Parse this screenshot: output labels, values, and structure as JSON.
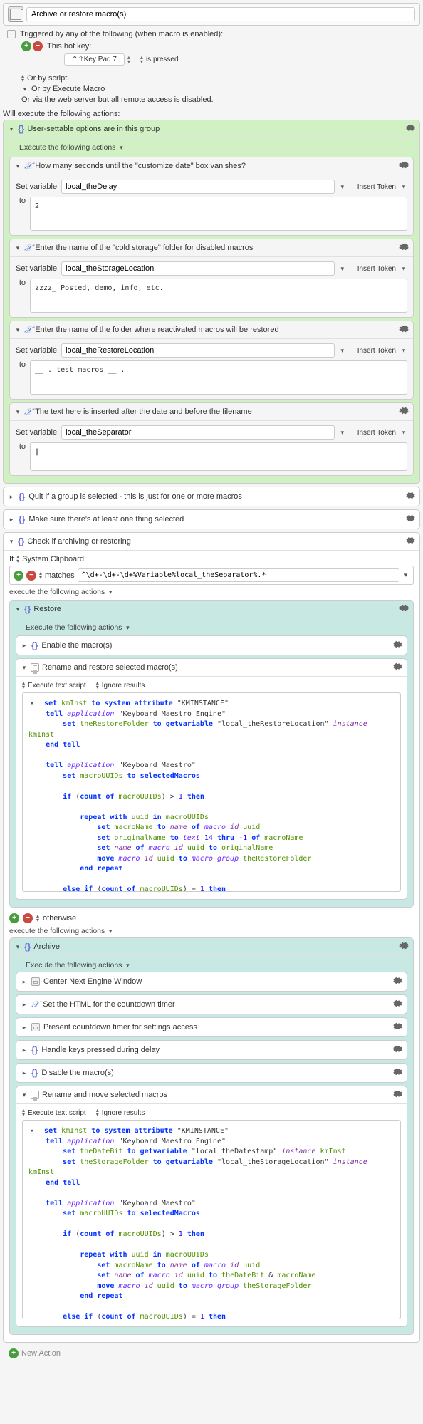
{
  "title": "Archive or restore macro(s)",
  "trigger_label": "Triggered by any of the following (when macro is enabled):",
  "hotkey_label": "This hot key:",
  "hotkey_value": "⌃⇧Key Pad 7",
  "hotkey_mode": "is pressed",
  "trig_or_script": "Or by script.",
  "trig_or_execute": "Or by Execute Macro",
  "trig_or_web": "Or via the web server but all remote access is disabled.",
  "will_execute": "Will execute the following actions:",
  "user_opts_title": "User-settable options are in this group",
  "exec_following": "Execute the following actions",
  "setvars": [
    {
      "title": "How many seconds until the \"customize date\" box vanishes?",
      "label": "Set variable",
      "name": "local_theDelay",
      "insert": "Insert Token",
      "to": "to",
      "value": "2"
    },
    {
      "title": "Enter the name of the \"cold storage\" folder for disabled macros",
      "label": "Set variable",
      "name": "local_theStorageLocation",
      "insert": "Insert Token",
      "to": "to",
      "value": "zzzz_ Posted, demo, info, etc."
    },
    {
      "title": "Enter the name of the folder where reactivated macros will be restored",
      "label": "Set variable",
      "name": "local_theRestoreLocation",
      "insert": "Insert Token",
      "to": "to",
      "value": "__ . test macros __ ."
    },
    {
      "title": "The text here is inserted after the date and before the filename",
      "label": "Set variable",
      "name": "local_theSeparator",
      "insert": "Insert Token",
      "to": "to",
      "value": ""
    }
  ],
  "quit_group": "Quit if a group is selected - this is just for one or more macros",
  "make_sure": "Make sure there's at least one thing selected",
  "check_title": "Check if archiving or restoring",
  "if_clip": "If",
  "sys_clip": "System Clipboard",
  "matches": "matches",
  "regex": "^\\d+-\\d+-\\d+%Variable%local_theSeparator%.*",
  "exec_actions_lc": "execute the following actions",
  "restore_title": "Restore",
  "enable_macros": "Enable the macro(s)",
  "rename_restore": "Rename and restore selected macro(s)",
  "exec_text_script": "Execute text script",
  "ignore_results": "Ignore results",
  "otherwise": "otherwise",
  "archive_title": "Archive",
  "a1": "Center Next Engine Window",
  "a2": "Set the HTML for the countdown timer",
  "a3": "Present countdown timer for settings access",
  "a4": "Handle keys pressed during delay",
  "a5": "Disable the macro(s)",
  "a6": "Rename and move selected macros",
  "new_action": "New Action"
}
